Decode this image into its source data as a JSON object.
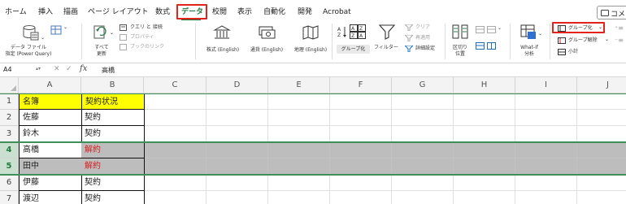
{
  "tabs": [
    "ホーム",
    "挿入",
    "描画",
    "ページ レイアウト",
    "数式",
    "データ",
    "校閲",
    "表示",
    "自動化",
    "開発",
    "Acrobat"
  ],
  "active_tab": "データ",
  "comment_button": "コメント",
  "ribbon": {
    "get_data_label_1": "データ ファイル",
    "get_data_label_2": "指定 (Power Query)",
    "refresh_label_1": "すべて",
    "refresh_label_2": "更新",
    "queries_label": "クエリ と 接続",
    "properties_label": "プロパティ",
    "workbook_links_label": "ブックのリンク",
    "data_types": [
      "株式 (English)",
      "通貨 (English)",
      "地理 (English)"
    ],
    "sort_az": "A→Z",
    "sort_za": "Z→A",
    "group_button": "グループ化",
    "filter_label": "フィルター",
    "clear_label": "クリア",
    "reapply_label": "再適用",
    "advanced_label": "詳細設定",
    "split_label_1": "区切り",
    "split_label_2": "位置",
    "whatif_label_1": "What-if",
    "whatif_label_2": "分析",
    "outline_group": "グループ化",
    "outline_ungroup": "グループ解除",
    "outline_subtotal": "小計"
  },
  "formula_bar": {
    "name_box": "A4",
    "value": "高橋"
  },
  "columns": [
    "A",
    "B",
    "C",
    "D",
    "E",
    "F",
    "G",
    "H",
    "I",
    "J"
  ],
  "rows": [
    {
      "num": "1",
      "a": "名簿",
      "b": "契約状況"
    },
    {
      "num": "2",
      "a": "佐藤",
      "b": "契約"
    },
    {
      "num": "3",
      "a": "鈴木",
      "b": "契約"
    },
    {
      "num": "4",
      "a": "高橋",
      "b": "解約"
    },
    {
      "num": "5",
      "a": "田中",
      "b": "解約"
    },
    {
      "num": "6",
      "a": "伊藤",
      "b": "契約"
    },
    {
      "num": "7",
      "a": "渡辺",
      "b": "契約"
    }
  ],
  "colors": {
    "accent_green": "#1f7a3f",
    "highlight_red": "#e0241b",
    "header_yellow": "#ffff00",
    "cancel_text_red": "#d81e1e"
  }
}
